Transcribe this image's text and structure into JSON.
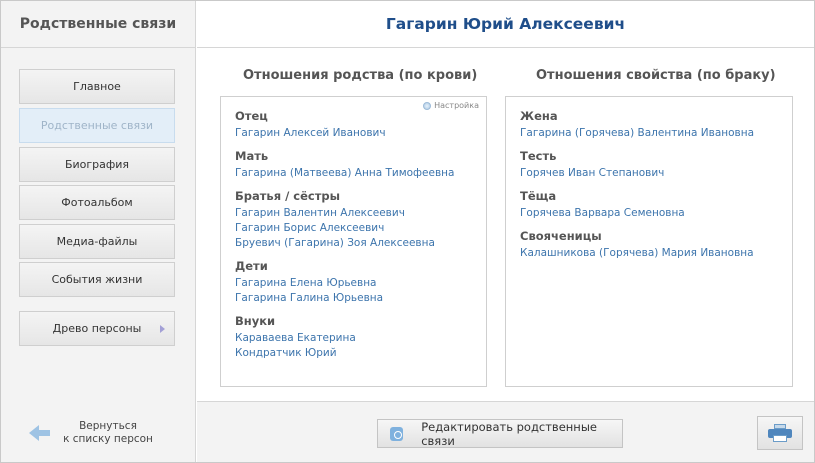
{
  "sidebar": {
    "title": "Родственные связи",
    "nav": [
      {
        "label": "Главное"
      },
      {
        "label": "Родственные связи"
      },
      {
        "label": "Биография"
      },
      {
        "label": "Фотоальбом"
      },
      {
        "label": "Медиа-файлы"
      },
      {
        "label": "События жизни"
      }
    ],
    "tree": {
      "label": "Древо персоны"
    },
    "back": {
      "line1": "Вернуться",
      "line2": "к списку персон"
    }
  },
  "header": {
    "name": "Гагарин Юрий Алексеевич"
  },
  "blood": {
    "title": "Отношения родства (по крови)",
    "settings": "Настройка",
    "groups": [
      {
        "label": "Отец",
        "people": [
          "Гагарин Алексей Иванович"
        ]
      },
      {
        "label": "Мать",
        "people": [
          "Гагарина (Матвеева) Анна Тимофеевна"
        ]
      },
      {
        "label": "Братья / сёстры",
        "people": [
          "Гагарин Валентин Алексеевич",
          "Гагарин Борис Алексеевич",
          "Бруевич (Гагарина) Зоя Алексеевна"
        ]
      },
      {
        "label": "Дети",
        "people": [
          "Гагарина Елена Юрьевна",
          "Гагарина Галина Юрьевна"
        ]
      },
      {
        "label": "Внуки",
        "people": [
          "Караваева Екатерина",
          "Кондратчик Юрий"
        ]
      }
    ]
  },
  "marriage": {
    "title": "Отношения свойства (по браку)",
    "groups": [
      {
        "label": "Жена",
        "people": [
          "Гагарина (Горячева) Валентина Ивановна"
        ]
      },
      {
        "label": "Тесть",
        "people": [
          "Горячев Иван Степанович"
        ]
      },
      {
        "label": "Тёща",
        "people": [
          "Горячева Варвара Семеновна"
        ]
      },
      {
        "label": "Свояченицы",
        "people": [
          "Калашникова (Горячева) Мария Ивановна"
        ]
      }
    ]
  },
  "footer": {
    "edit_label": "Редактировать родственные связи"
  },
  "icons": {
    "back": "arrow-left-icon",
    "settings": "settings-icon",
    "edit": "edit-link-icon",
    "print": "printer-icon"
  },
  "colors": {
    "accent": "#1f4e8a",
    "link": "#3c74ac",
    "active_nav": "#e3eef8"
  }
}
